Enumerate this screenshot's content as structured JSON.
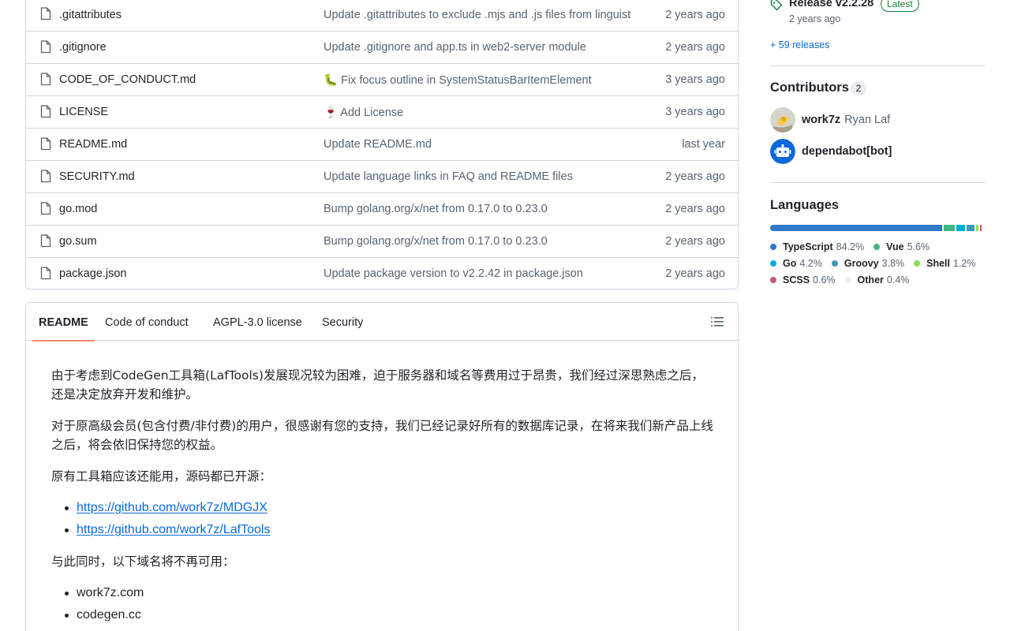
{
  "files": [
    {
      "name": ".gitattributes",
      "message": "Update .gitattributes to exclude .mjs and .js files from linguist",
      "date": "2 years ago"
    },
    {
      "name": ".gitignore",
      "message": "Update .gitignore and app.ts in web2-server module",
      "date": "2 years ago"
    },
    {
      "name": "CODE_OF_CONDUCT.md",
      "message": "🐛 Fix focus outline in SystemStatusBarItemElement",
      "date": "3 years ago"
    },
    {
      "name": "LICENSE",
      "message": "🍷 Add License",
      "date": "3 years ago"
    },
    {
      "name": "README.md",
      "message": "Update README.md",
      "date": "last year"
    },
    {
      "name": "SECURITY.md",
      "message": "Update language links in FAQ and README files",
      "date": "2 years ago"
    },
    {
      "name": "go.mod",
      "message": "Bump golang.org/x/net from 0.17.0 to 0.23.0",
      "date": "2 years ago"
    },
    {
      "name": "go.sum",
      "message": "Bump golang.org/x/net from 0.17.0 to 0.23.0",
      "date": "2 years ago"
    },
    {
      "name": "package.json",
      "message": "Update package version to v2.2.42 in package.json",
      "date": "2 years ago"
    }
  ],
  "readme": {
    "tabs": [
      "README",
      "Code of conduct",
      "AGPL-3.0 license",
      "Security"
    ],
    "active_tab": "README",
    "p1": "由于考虑到CodeGen工具箱(LafTools)发展现况较为困难，迫于服务器和域名等费用过于昂贵，我们经过深思熟虑之后，还是决定放弃开发和维护。",
    "p2": "对于原高级会员(包含付费/非付费)的用户，很感谢有您的支持，我们已经记录好所有的数据库记录，在将来我们新产品上线之后，将会依旧保持您的权益。",
    "p3": "原有工具箱应该还能用，源码都已开源：",
    "links": [
      "https://github.com/work7z/MDGJX",
      "https://github.com/work7z/LafTools"
    ],
    "p4": "与此同时，以下域名将不再可用：",
    "domains": [
      "work7z.com",
      "codegen.cc"
    ]
  },
  "sidebar": {
    "release": {
      "title": "Release v2.2.28",
      "badge": "Latest",
      "date": "2 years ago",
      "more": "+ 59 releases"
    },
    "contributors": {
      "title": "Contributors",
      "count": "2",
      "items": [
        {
          "login": "work7z",
          "name": "Ryan Laf"
        },
        {
          "login": "dependabot[bot]",
          "name": ""
        }
      ]
    },
    "languages": {
      "title": "Languages",
      "items": [
        {
          "name": "TypeScript",
          "pct": "84.2%",
          "value": 84.2,
          "color": "#3178c6"
        },
        {
          "name": "Vue",
          "pct": "5.6%",
          "value": 5.6,
          "color": "#41b883"
        },
        {
          "name": "Go",
          "pct": "4.2%",
          "value": 4.2,
          "color": "#00add8"
        },
        {
          "name": "Groovy",
          "pct": "3.8%",
          "value": 3.8,
          "color": "#4298b8"
        },
        {
          "name": "Shell",
          "pct": "1.2%",
          "value": 1.2,
          "color": "#89e051"
        },
        {
          "name": "SCSS",
          "pct": "0.6%",
          "value": 0.6,
          "color": "#c6538c"
        },
        {
          "name": "Other",
          "pct": "0.4%",
          "value": 0.4,
          "color": "#ededed"
        }
      ]
    }
  }
}
